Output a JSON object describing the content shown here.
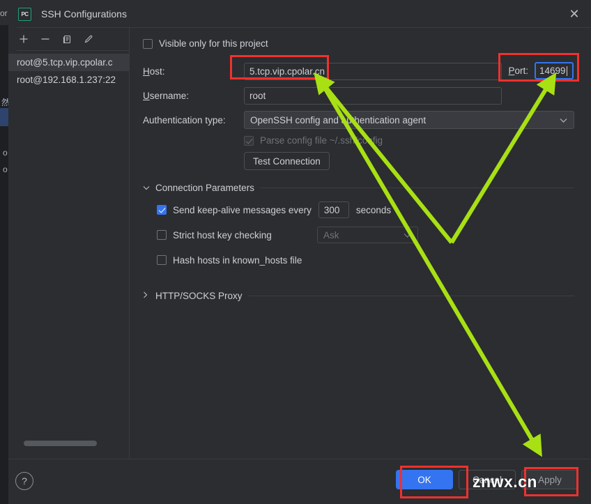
{
  "window": {
    "title": "SSH Configurations",
    "app_icon": "pycharm-icon",
    "app_icon_text": "PC",
    "close_icon": "close-icon"
  },
  "background_window": {
    "fragments": [
      "or",
      "然",
      "o",
      "o"
    ]
  },
  "sidebar": {
    "toolbar": [
      {
        "name": "add-button",
        "glyph": "+"
      },
      {
        "name": "remove-button",
        "glyph": "−"
      },
      {
        "name": "copy-button",
        "glyph": "⎘"
      },
      {
        "name": "edit-button",
        "glyph": "✎"
      }
    ],
    "items": [
      {
        "label": "root@5.tcp.vip.cpolar.c",
        "selected": true
      },
      {
        "label": "root@192.168.1.237:22",
        "selected": false
      }
    ],
    "scrollbar": "horizontal-scrollbar"
  },
  "form": {
    "visible_only_label": "Visible only for this project",
    "visible_only_checked": false,
    "host_label": "Host:",
    "host_value": "5.tcp.vip.cpolar.cn",
    "port_label": "Port:",
    "port_value": "14699",
    "username_label": "Username:",
    "username_value": "root",
    "auth_type_label": "Authentication type:",
    "auth_type_value": "OpenSSH config and authentication agent",
    "auth_dropdown_icon": "chevron-down-icon",
    "parse_config_label": "Parse config file ~/.ssh/config",
    "parse_config_checked": true,
    "parse_config_disabled": true,
    "test_connection_label": "Test Connection"
  },
  "connection_parameters": {
    "section_title": "Connection Parameters",
    "expanded": true,
    "expand_icon": "chevron-down-icon",
    "keepalive_label": "Send keep-alive messages every",
    "keepalive_checked": true,
    "keepalive_value": "300",
    "keepalive_unit": "seconds",
    "strict_host_label": "Strict host key checking",
    "strict_host_checked": false,
    "strict_host_value": "Ask",
    "strict_dropdown_icon": "chevron-down-icon",
    "hash_hosts_label": "Hash hosts in known_hosts file",
    "hash_hosts_checked": false
  },
  "proxy_section": {
    "section_title": "HTTP/SOCKS Proxy",
    "expanded": false,
    "expand_icon": "chevron-right-icon"
  },
  "footer": {
    "help_label": "?",
    "ok_label": "OK",
    "cancel_label": "Cancel",
    "apply_label": "Apply"
  },
  "annotations": {
    "watermark": "znwx.cn",
    "highlight_color": "#f0312e",
    "arrow_color": "#a8e014",
    "focus_color": "#3574f0",
    "accent_color": "#3574f0"
  }
}
